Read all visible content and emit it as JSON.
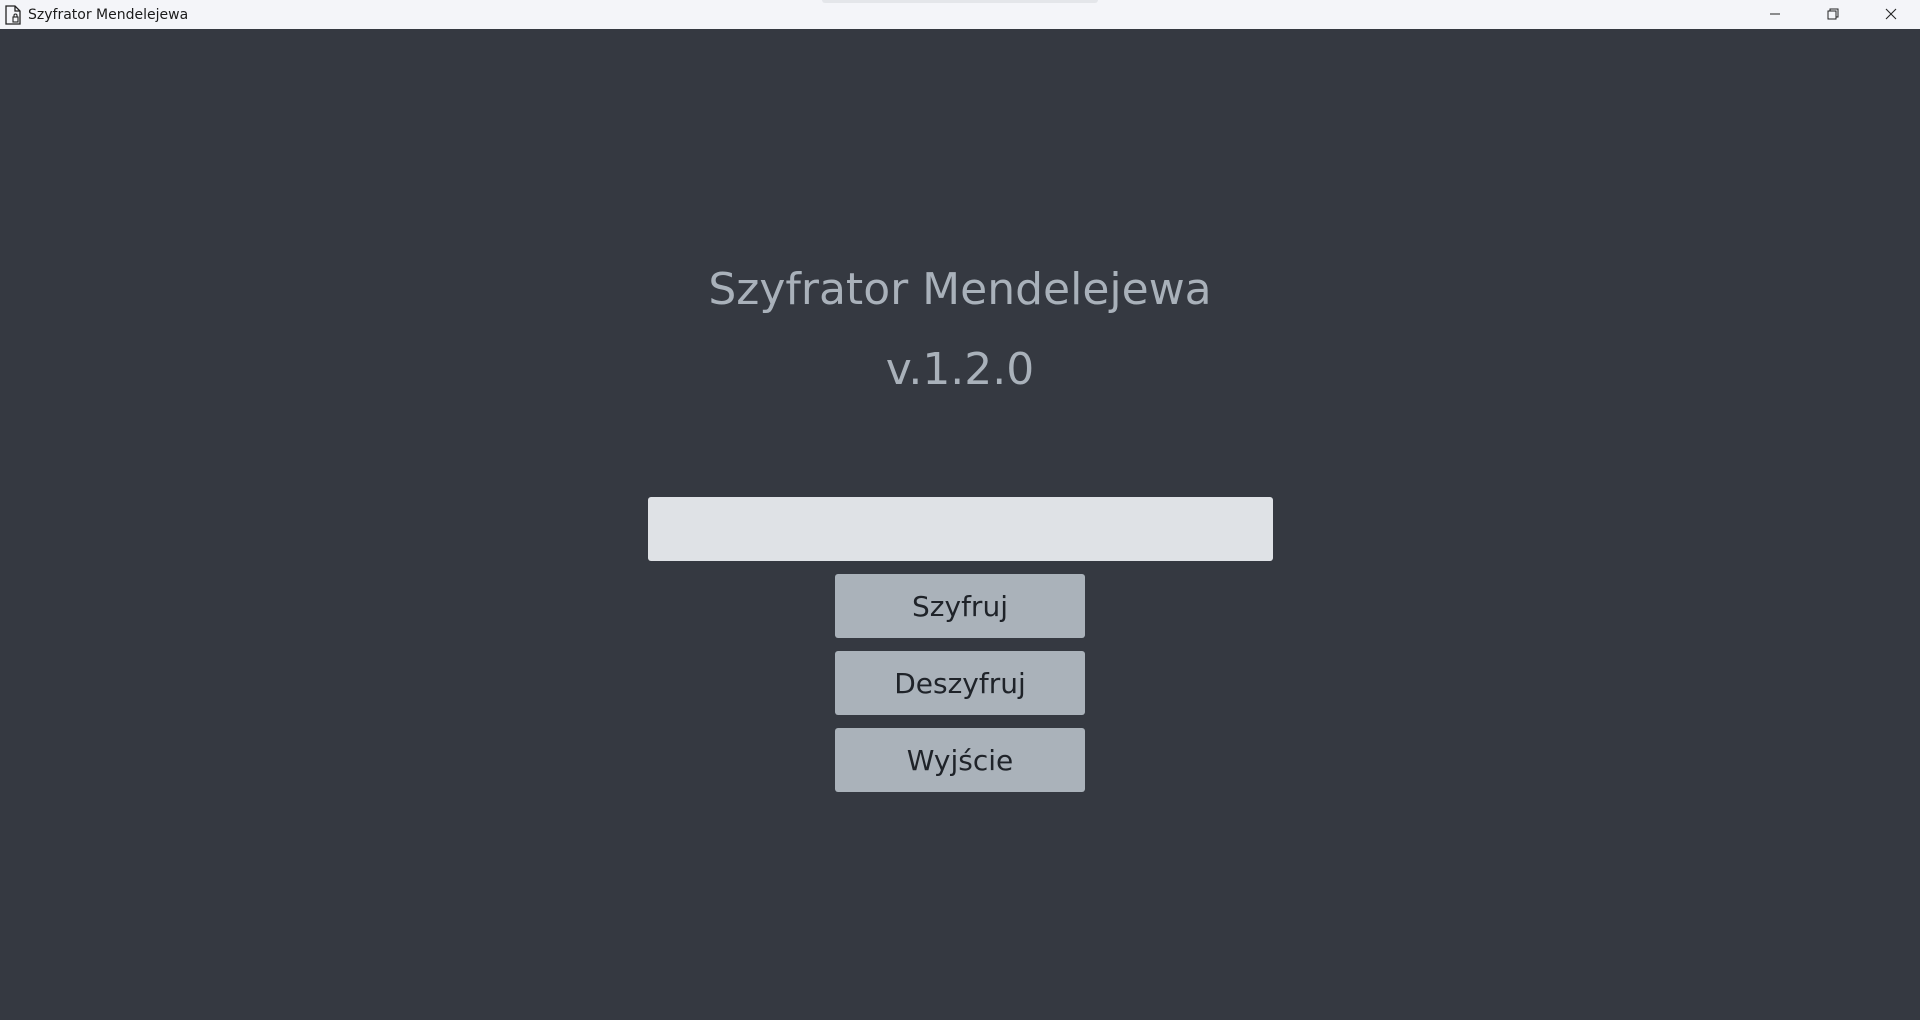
{
  "window": {
    "title": "Szyfrator Mendelejewa",
    "controls": {
      "minimize_icon": "minimize-icon",
      "restore_icon": "restore-icon",
      "close_icon": "close-icon"
    }
  },
  "main": {
    "title": "Szyfrator Mendelejewa",
    "version": "v.1.2.0",
    "input": {
      "value": "",
      "placeholder": ""
    },
    "buttons": {
      "encrypt": "Szyfruj",
      "decrypt": "Deszyfruj",
      "exit": "Wyjście"
    }
  },
  "colors": {
    "background": "#353941",
    "titlebar": "#f4f5f9",
    "heading_text": "#a9b1ba",
    "input_bg": "#dfe2e6",
    "button_bg": "#aab2ba",
    "button_text": "#1f2329"
  }
}
